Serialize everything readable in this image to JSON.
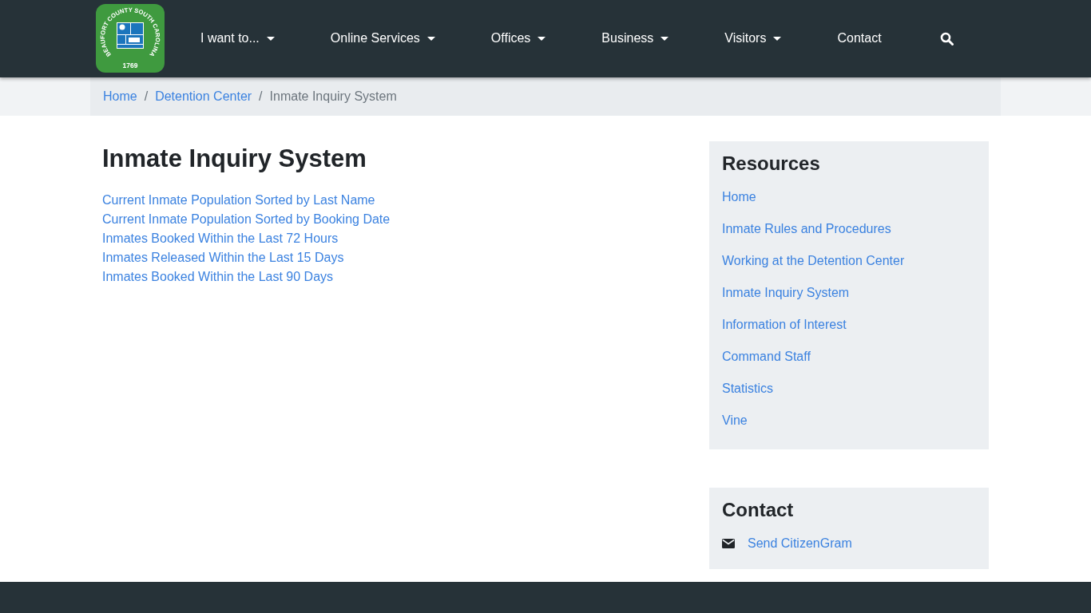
{
  "logo": {
    "ring_text": "BEAUFORT COUNTY SOUTH CAROLINA",
    "year": "1769"
  },
  "nav": [
    {
      "label": "I want to...",
      "dropdown": true
    },
    {
      "label": "Online Services",
      "dropdown": true
    },
    {
      "label": "Offices",
      "dropdown": true
    },
    {
      "label": "Business",
      "dropdown": true
    },
    {
      "label": "Visitors",
      "dropdown": true
    },
    {
      "label": "Contact",
      "dropdown": false
    }
  ],
  "breadcrumb_separators": [
    "/",
    "/"
  ],
  "breadcrumb": [
    {
      "label": "Home",
      "current": false
    },
    {
      "label": "Detention Center",
      "current": false
    },
    {
      "label": "Inmate Inquiry System",
      "current": true
    }
  ],
  "page_title": "Inmate Inquiry System",
  "links": [
    "Current Inmate Population Sorted by Last Name",
    "Current Inmate Population Sorted by Booking Date",
    "Inmates Booked Within the Last 72 Hours",
    "Inmates Released Within the Last 15 Days",
    "Inmates Booked Within the Last 90 Days"
  ],
  "resources": {
    "title": "Resources",
    "items": [
      "Home",
      "Inmate Rules and Procedures",
      "Working at the Detention Center",
      "Inmate Inquiry System",
      "Information of Interest",
      "Command Staff",
      "Statistics",
      "Vine"
    ]
  },
  "contact": {
    "title": "Contact",
    "link": "Send CitizenGram"
  }
}
